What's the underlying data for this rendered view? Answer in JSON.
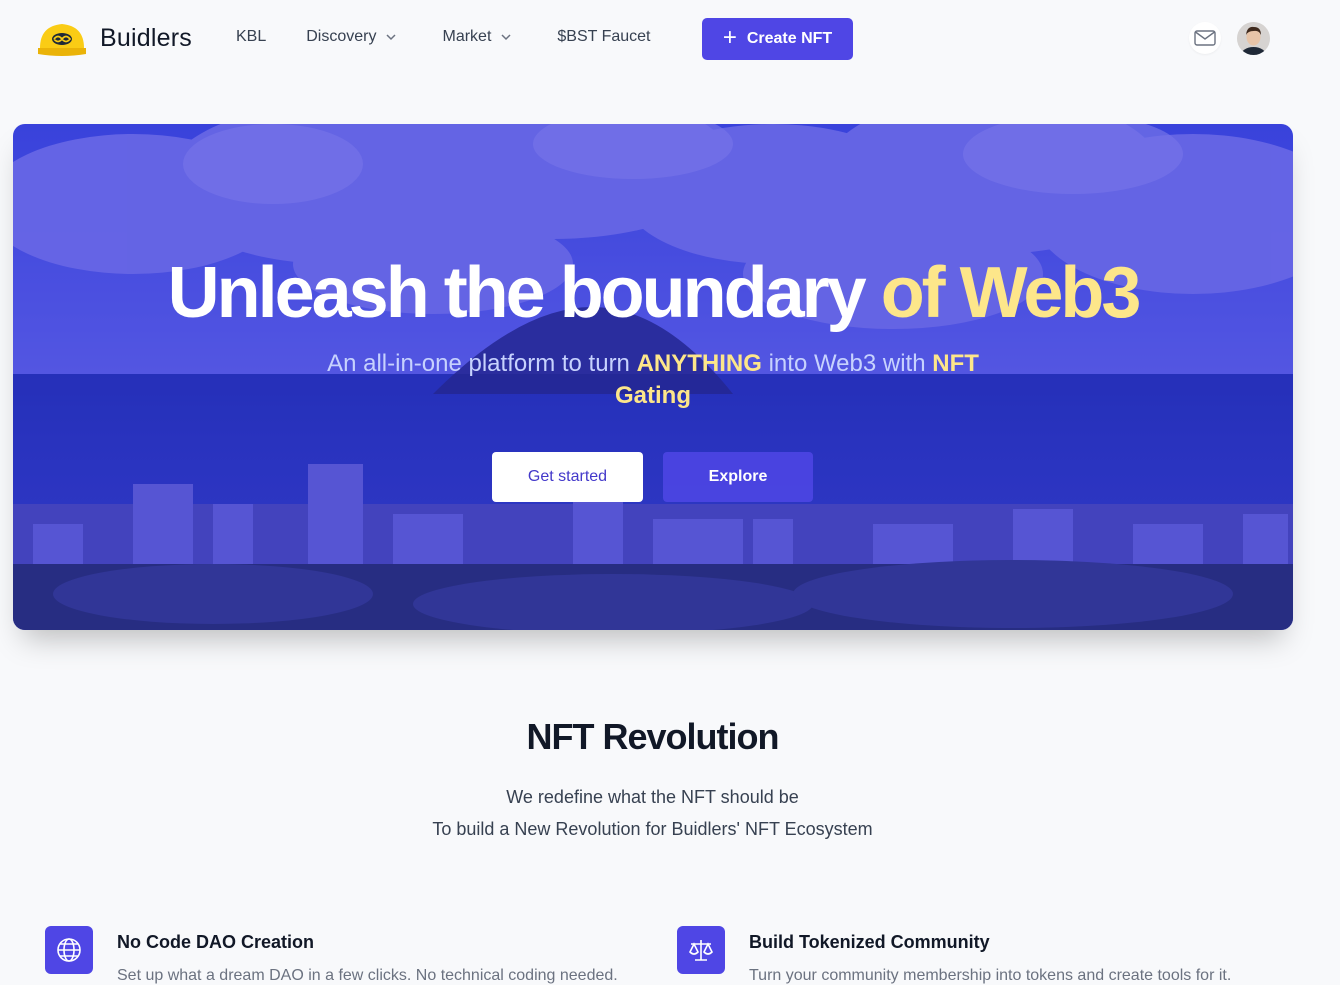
{
  "brand": {
    "name": "Buidlers"
  },
  "nav": {
    "items": [
      {
        "label": "KBL",
        "has_dropdown": false
      },
      {
        "label": "Discovery",
        "has_dropdown": true
      },
      {
        "label": "Market",
        "has_dropdown": true
      },
      {
        "label": "$BST Faucet",
        "has_dropdown": false
      }
    ],
    "create_label": "Create NFT"
  },
  "icons": {
    "mail": "mail-icon",
    "avatar": "user-avatar",
    "plus": "plus-icon",
    "chevron": "chevron-down-icon",
    "globe": "globe-icon",
    "scale": "scale-icon"
  },
  "hero": {
    "title_main": "Unleash the boundary ",
    "title_accent": "of Web3",
    "subtitle_parts": [
      "An all-in-one platform to turn ",
      "ANYTHING",
      " into Web3 with ",
      "NFT Gating"
    ],
    "get_started": "Get started",
    "explore": "Explore"
  },
  "section": {
    "title": "NFT Revolution",
    "line1": "We redefine what the NFT should be",
    "line2": "To build a New Revolution for Buidlers' NFT Ecosystem"
  },
  "features": [
    {
      "title": "No Code DAO Creation",
      "desc": "Set up what a dream DAO in a few clicks. No technical coding needed."
    },
    {
      "title": "Build Tokenized Community",
      "desc": "Turn your community membership into tokens and create tools for it."
    }
  ],
  "colors": {
    "accent": "#4f46e5",
    "highlight": "#fde68a",
    "brand_yellow": "#facc15"
  }
}
